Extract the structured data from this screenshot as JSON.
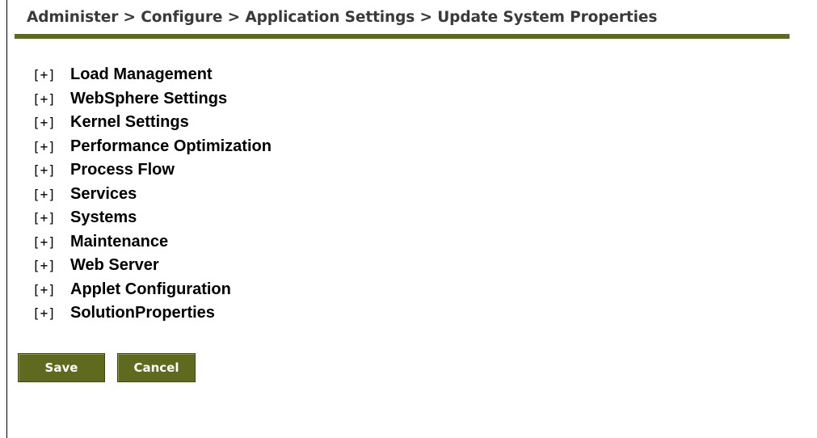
{
  "breadcrumb": "Administer > Configure > Application Settings > Update System Properties",
  "tree": {
    "expand_symbol": "[+]",
    "items": [
      {
        "label": "Load Management"
      },
      {
        "label": "WebSphere Settings"
      },
      {
        "label": "Kernel Settings"
      },
      {
        "label": "Performance Optimization"
      },
      {
        "label": "Process Flow"
      },
      {
        "label": "Services"
      },
      {
        "label": "Systems"
      },
      {
        "label": "Maintenance"
      },
      {
        "label": "Web Server"
      },
      {
        "label": "Applet Configuration"
      },
      {
        "label": "SolutionProperties"
      }
    ]
  },
  "actions": {
    "save_label": "Save",
    "cancel_label": "Cancel"
  },
  "colors": {
    "accent": "#5f6a1f",
    "breadcrumb_text": "#3a3a3a"
  }
}
